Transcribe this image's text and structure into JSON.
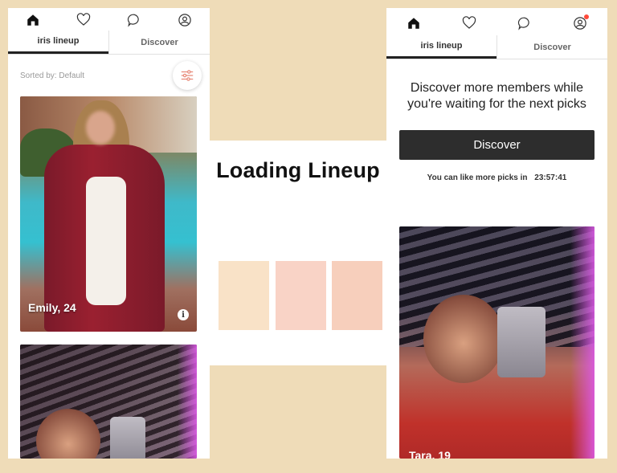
{
  "left_screen": {
    "nav_icons": [
      "home-icon",
      "heart-icon",
      "chat-icon",
      "profile-icon"
    ],
    "tabs": [
      {
        "label": "iris lineup",
        "active": true
      },
      {
        "label": "Discover",
        "active": false
      }
    ],
    "sort_label": "Sorted by: Default",
    "cards": [
      {
        "name": "Emily, 24"
      }
    ],
    "info_glyph": "i"
  },
  "middle": {
    "title": "Loading Lineup",
    "swatch_colors": [
      "#f9e2c7",
      "#f9d3c6",
      "#f7cfbc"
    ]
  },
  "right_screen": {
    "nav_icons": [
      "home-icon",
      "heart-icon",
      "chat-icon",
      "profile-icon"
    ],
    "tabs": [
      {
        "label": "iris lineup",
        "active": true
      },
      {
        "label": "Discover",
        "active": false
      }
    ],
    "discover_message": "Discover more members while you're waiting for the next picks",
    "discover_button": "Discover",
    "timer_text": "You can like more picks in",
    "timer_value": "23:57:41",
    "card_name_partial": "Tara, 19"
  },
  "colors": {
    "background": "#efdcb8",
    "button_dark": "#2d2d2d",
    "filter_accent": "#e88a7a",
    "notification_dot": "#ff4a3a"
  }
}
